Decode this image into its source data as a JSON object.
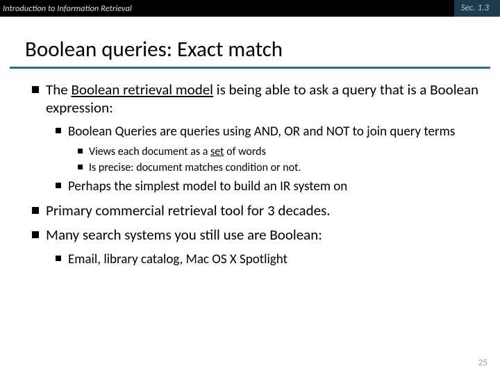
{
  "topbar": {
    "left": "Introduction to Information Retrieval",
    "section": "Sec. 1.3"
  },
  "title": "Boolean queries: Exact match",
  "bullet1": {
    "pre": "The ",
    "underlined": "Boolean retrieval model",
    "post": " is being able to ask a query that is a Boolean expression:"
  },
  "bullet1_1": "Boolean Queries are queries using AND, OR and NOT to join query terms",
  "bullet1_1_1_pre": "Views each document as a ",
  "bullet1_1_1_ul": "set",
  "bullet1_1_1_post": " of words",
  "bullet1_1_2": "Is precise: document matches condition or not.",
  "bullet1_2": "Perhaps the simplest model to build an IR system on",
  "bullet2": "Primary commercial retrieval tool for 3 decades.",
  "bullet3": "Many search systems you still use are Boolean:",
  "bullet3_1": "Email, library catalog, Mac OS X Spotlight",
  "pagenum": "25"
}
